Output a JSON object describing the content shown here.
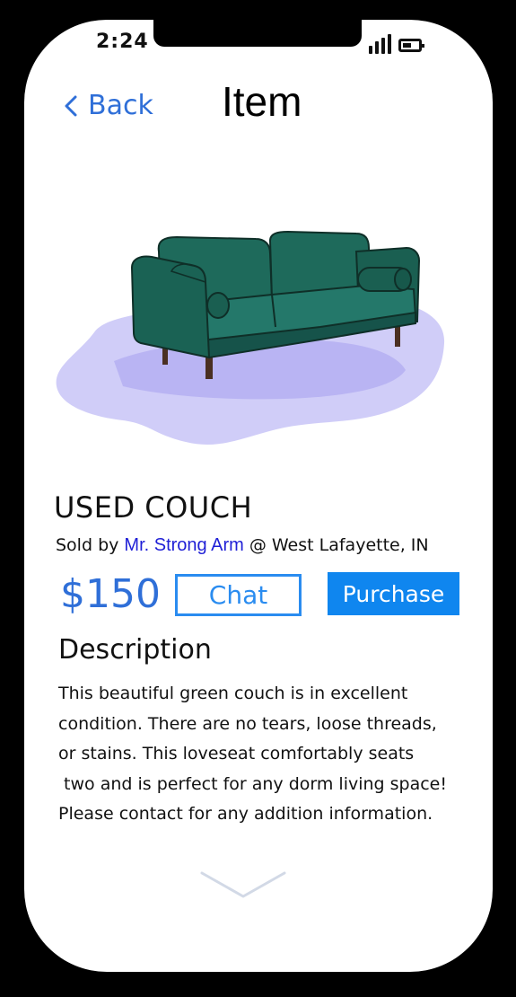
{
  "status_bar": {
    "time": "2:24"
  },
  "header": {
    "back_label": "Back",
    "title": "Item"
  },
  "item": {
    "name": "USED COUCH",
    "sold_by_prefix": "Sold by",
    "seller": "Mr. Strong Arm",
    "location": "@ West Lafayette, IN",
    "price": "$150",
    "image_icon": "green-couch-illustration"
  },
  "actions": {
    "chat_label": "Chat",
    "purchase_label": "Purchase"
  },
  "description": {
    "heading": "Description",
    "lines": [
      "This beautiful green couch is in excellent",
      "condition. There are no tears, loose threads,",
      "or stains. This loveseat comfortably seats",
      " two and is perfect for any dorm living space!",
      "Please contact for any addition information."
    ]
  },
  "colors": {
    "accent": "#2f6fd8",
    "button_fill": "#0f86ef",
    "seller_link": "#1f1fd6",
    "couch": "#1f6b5c",
    "shadow": "#a9a4f2"
  }
}
